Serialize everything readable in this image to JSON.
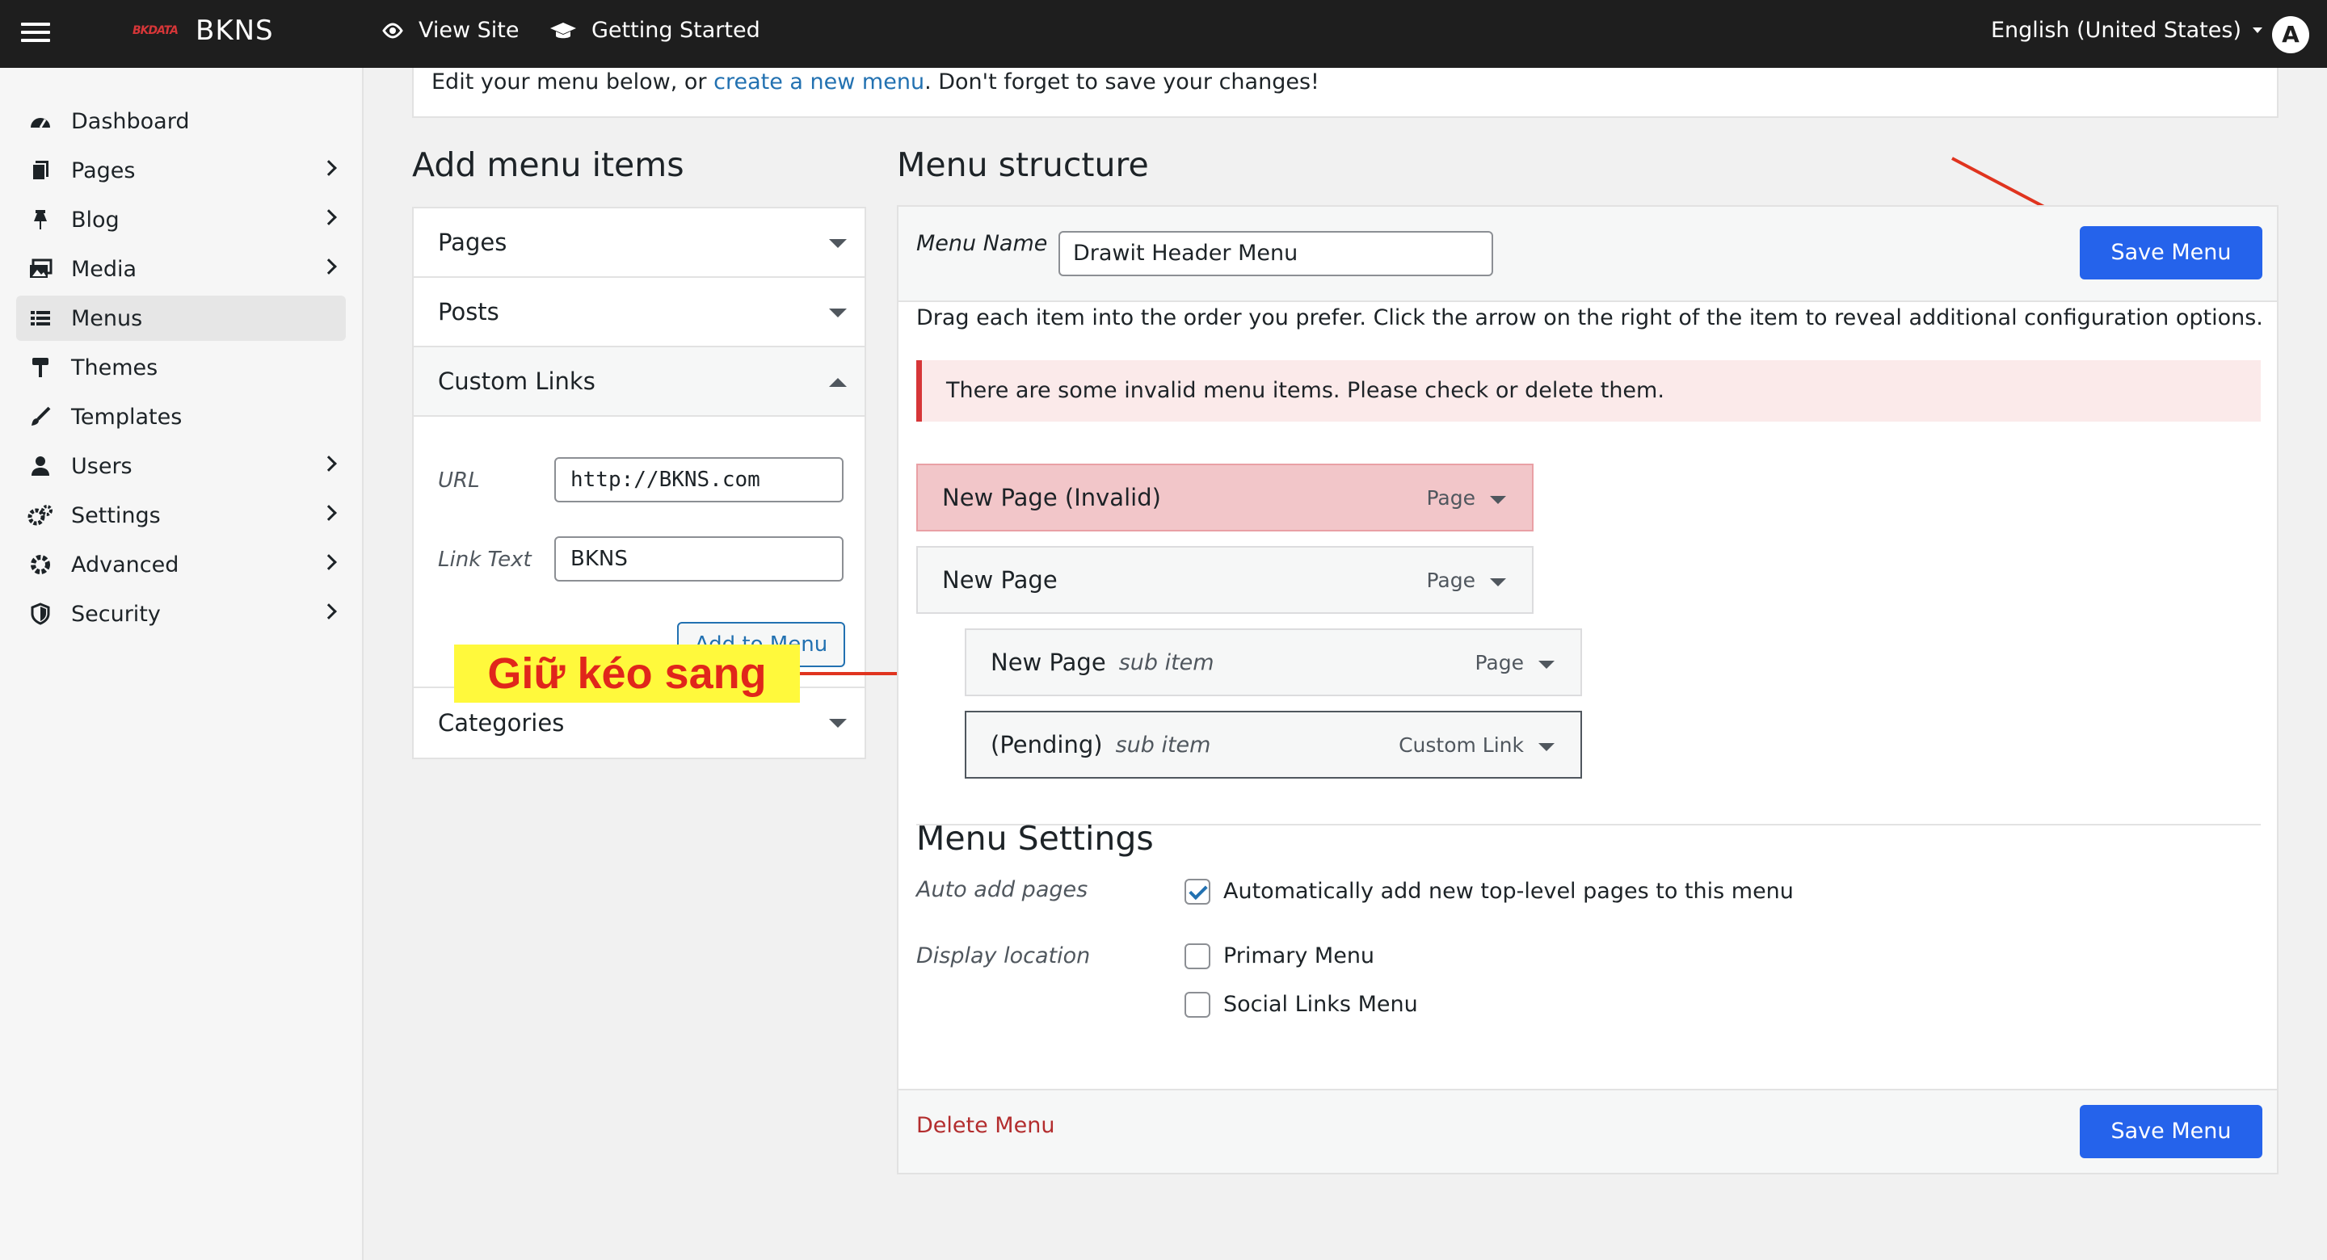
{
  "topbar": {
    "logo_text": "BKDATA",
    "brand": "BKNS",
    "view_site": "View Site",
    "getting_started": "Getting Started",
    "language": "English (United States)",
    "avatar_initial": "A"
  },
  "sidebar": {
    "items": [
      {
        "label": "Dashboard",
        "icon": "dashboard-icon",
        "has_submenu": false
      },
      {
        "label": "Pages",
        "icon": "pages-icon",
        "has_submenu": true
      },
      {
        "label": "Blog",
        "icon": "pin-icon",
        "has_submenu": true
      },
      {
        "label": "Media",
        "icon": "media-icon",
        "has_submenu": true
      },
      {
        "label": "Menus",
        "icon": "list-icon",
        "has_submenu": false,
        "active": true
      },
      {
        "label": "Themes",
        "icon": "paint-roller-icon",
        "has_submenu": false
      },
      {
        "label": "Templates",
        "icon": "brush-icon",
        "has_submenu": false
      },
      {
        "label": "Users",
        "icon": "user-icon",
        "has_submenu": true
      },
      {
        "label": "Settings",
        "icon": "gears-icon",
        "has_submenu": true
      },
      {
        "label": "Advanced",
        "icon": "gear-icon",
        "has_submenu": true
      },
      {
        "label": "Security",
        "icon": "shield-icon",
        "has_submenu": true
      }
    ]
  },
  "notice": {
    "prefix": "Edit your menu below, or ",
    "link": "create a new menu",
    "suffix": ". Don't forget to save your changes!"
  },
  "add_items": {
    "title": "Add menu items",
    "pages": "Pages",
    "posts": "Posts",
    "custom_links": "Custom Links",
    "url_label": "URL",
    "url_value": "http://BKNS.com",
    "link_text_label": "Link Text",
    "link_text_value": "BKNS",
    "add_button": "Add to Menu",
    "categories": "Categories"
  },
  "annotation": {
    "text": "Giữ kéo sang",
    "colors": {
      "background": "#fff93c",
      "text": "#e0261b",
      "arrow": "#e0341f"
    }
  },
  "menu_structure": {
    "title": "Menu structure",
    "menu_name_label": "Menu Name",
    "menu_name_value": "Drawit Header Menu",
    "save_button": "Save Menu",
    "description": "Drag each item into the order you prefer. Click the arrow on the right of the item to reveal additional configuration options.",
    "error": "There are some invalid menu items. Please check or delete them.",
    "items": [
      {
        "title": "New Page (Invalid)",
        "sub": "",
        "type": "Page",
        "state": "invalid"
      },
      {
        "title": "New Page",
        "sub": "",
        "type": "Page",
        "state": "normal"
      },
      {
        "title": "New Page",
        "sub": "sub item",
        "type": "Page",
        "state": "normal"
      },
      {
        "title": "(Pending)",
        "sub": "sub item",
        "type": "Custom Link",
        "state": "pending"
      }
    ]
  },
  "menu_settings": {
    "title": "Menu Settings",
    "auto_add_label": "Auto add pages",
    "auto_add_option": "Automatically add new top-level pages to this menu",
    "auto_add_checked": true,
    "display_location_label": "Display location",
    "primary_menu": "Primary Menu",
    "primary_checked": false,
    "social_links_menu": "Social Links Menu",
    "social_checked": false
  },
  "footer": {
    "delete_menu": "Delete Menu",
    "save_button": "Save Menu"
  },
  "colors": {
    "accent": "#2563eb",
    "link": "#2271b1",
    "danger": "#b32d2e",
    "error_bg": "#fbeaea",
    "invalid_item_bg": "#f2c6c9"
  }
}
